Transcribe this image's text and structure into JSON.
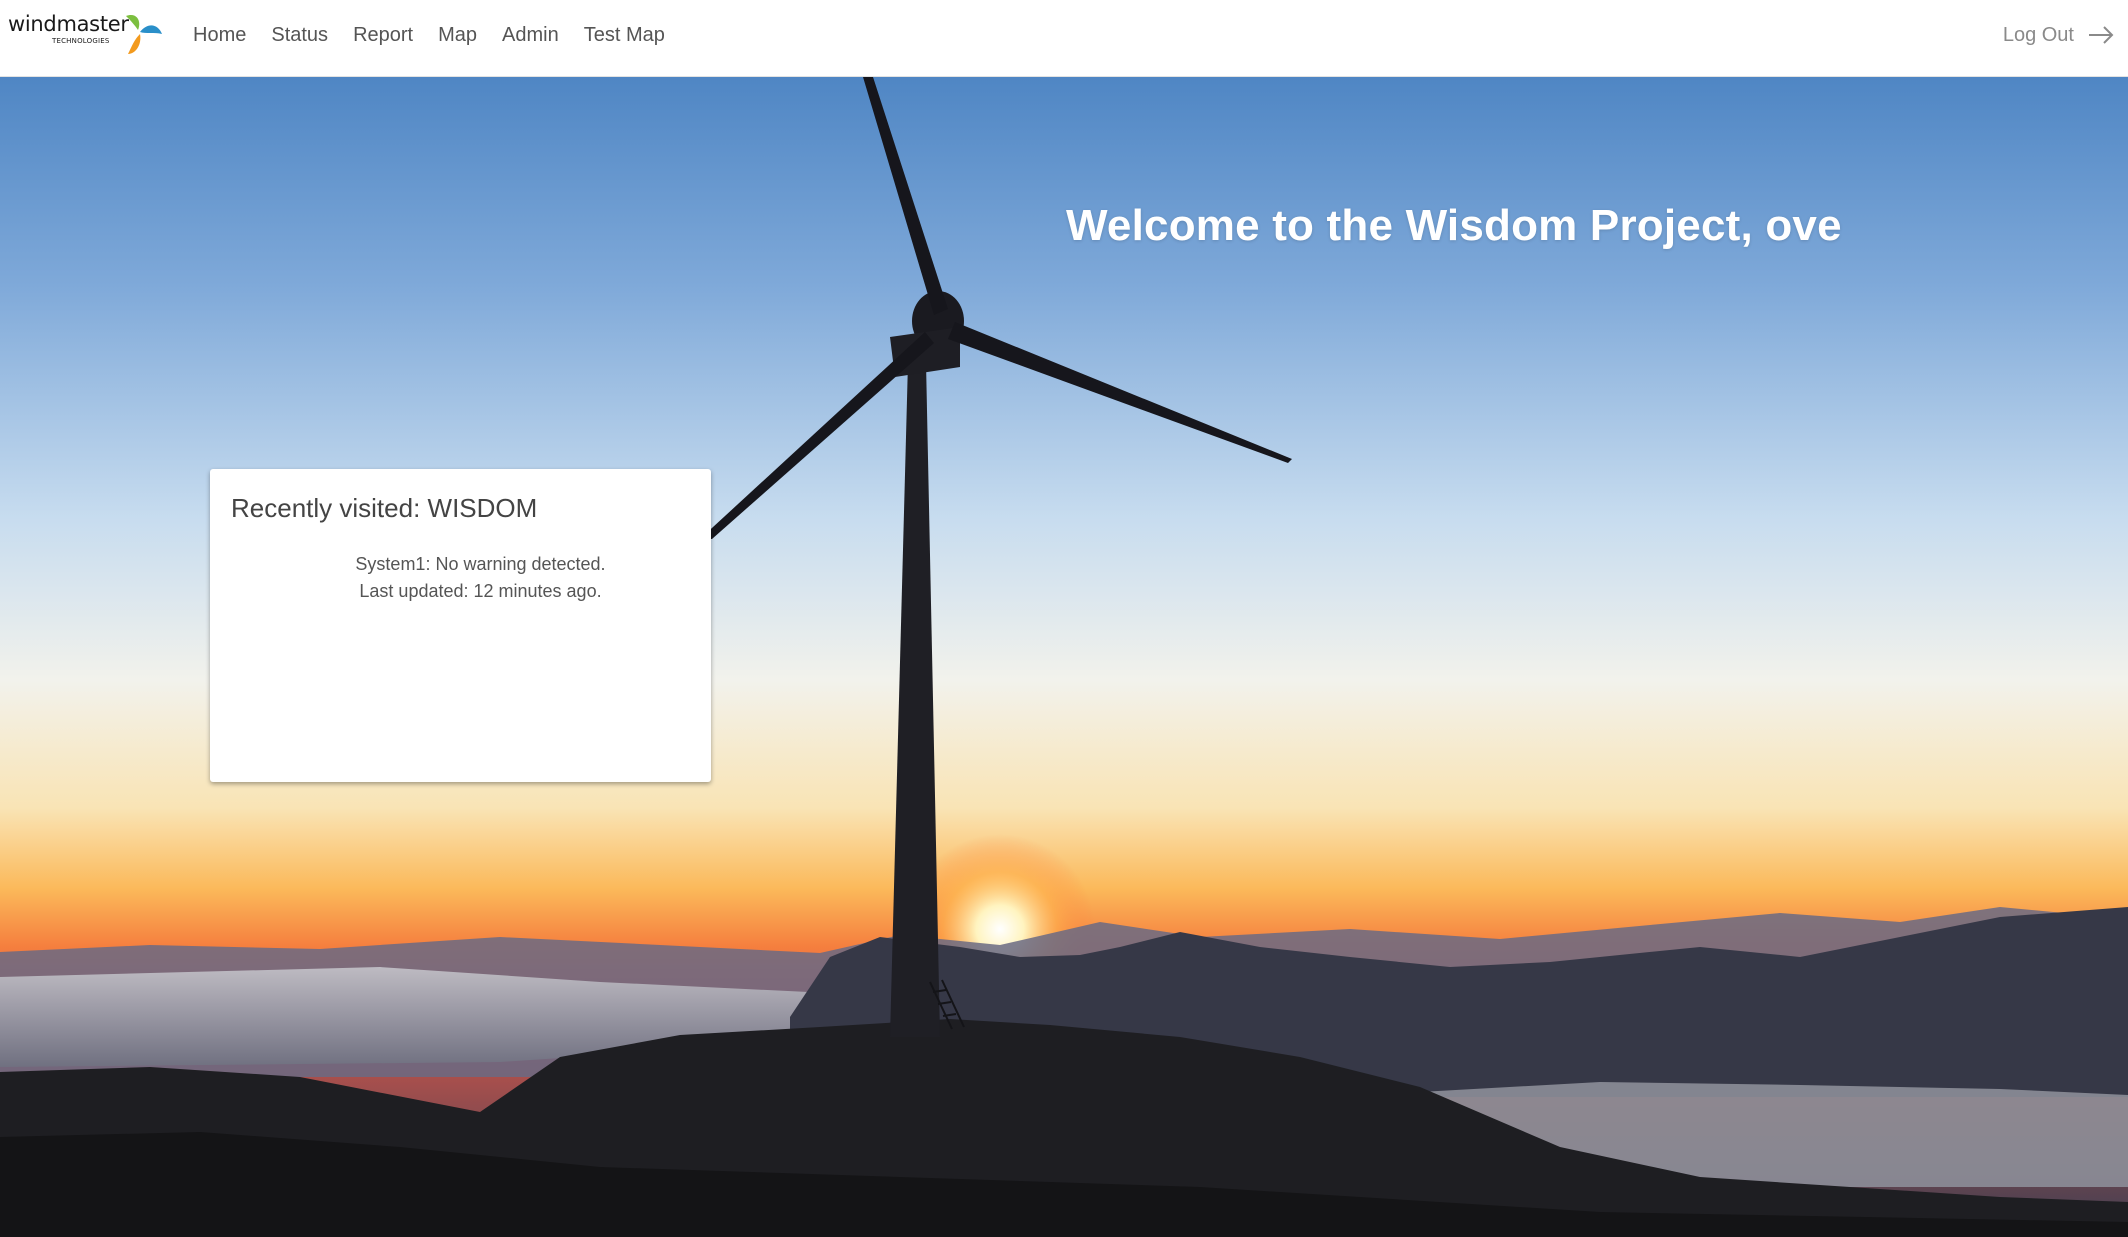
{
  "brand": {
    "name": "windmaster",
    "tagline": "TECHNOLOGIES",
    "colors": {
      "blue": "#2a8fc9",
      "green": "#7cbf3f",
      "orange": "#f39a1d"
    }
  },
  "nav": {
    "items": [
      {
        "label": "Home"
      },
      {
        "label": "Status"
      },
      {
        "label": "Report"
      },
      {
        "label": "Map"
      },
      {
        "label": "Admin"
      },
      {
        "label": "Test Map"
      }
    ],
    "logout_label": "Log Out"
  },
  "hero": {
    "welcome": "Welcome to the Wisdom Project, ove"
  },
  "recent": {
    "title": "Recently visited: WISDOM",
    "status": "System1: No warning detected.",
    "updated": "Last updated: 12 minutes ago."
  }
}
